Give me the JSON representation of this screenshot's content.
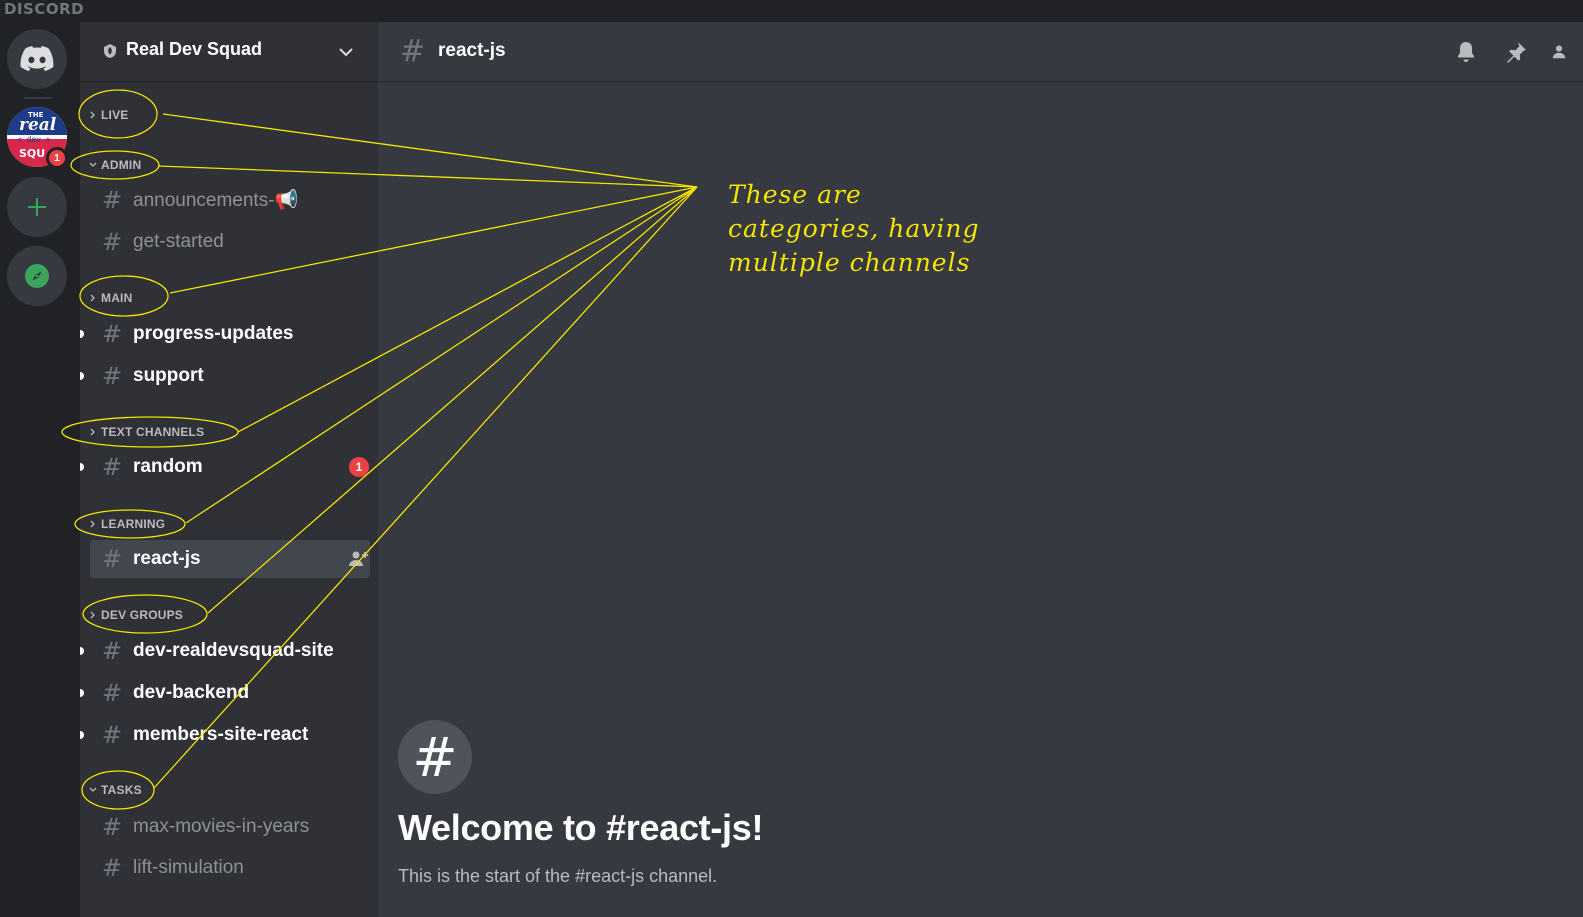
{
  "app": {
    "brand": "DISCORD"
  },
  "server": {
    "name": "Real Dev Squad",
    "notification_count": "1",
    "logo_text": {
      "the": "THE",
      "real": "real",
      "dev": "< dev >",
      "squad": "SQU"
    }
  },
  "sidebar": {
    "categories": [
      {
        "label": "LIVE",
        "expanded": false,
        "channels": []
      },
      {
        "label": "ADMIN",
        "expanded": true,
        "channels": [
          {
            "name": "announcements-📢",
            "state": "muted"
          },
          {
            "name": "get-started",
            "state": "muted"
          }
        ]
      },
      {
        "label": "MAIN",
        "expanded": false,
        "channels": [
          {
            "name": "progress-updates",
            "state": "unread"
          },
          {
            "name": "support",
            "state": "unread"
          }
        ]
      },
      {
        "label": "TEXT CHANNELS",
        "expanded": false,
        "channels": [
          {
            "name": "random",
            "state": "unread",
            "mention_count": "1"
          }
        ]
      },
      {
        "label": "LEARNING",
        "expanded": false,
        "channels": [
          {
            "name": "react-js",
            "state": "selected"
          }
        ]
      },
      {
        "label": "DEV GROUPS",
        "expanded": false,
        "channels": [
          {
            "name": "dev-realdevsquad-site",
            "state": "unread"
          },
          {
            "name": "dev-backend",
            "state": "unread"
          },
          {
            "name": "members-site-react",
            "state": "unread"
          }
        ]
      },
      {
        "label": "TASKS",
        "expanded": true,
        "channels": [
          {
            "name": "max-movies-in-years",
            "state": "muted"
          },
          {
            "name": "lift-simulation",
            "state": "muted"
          }
        ]
      }
    ]
  },
  "main": {
    "channel_title": "react-js",
    "welcome_title": "Welcome to #react-js!",
    "welcome_subtitle": "This is the start of the #react-js channel."
  },
  "annotation": {
    "lines": [
      "These are",
      "categories, having",
      "multiple channels"
    ],
    "color": "#f2e300"
  },
  "icons": {
    "home": "discord-logo-icon",
    "add_server": "plus-icon",
    "explore": "compass-icon",
    "server_boost": "shield-icon",
    "server_menu": "chevron-down-icon",
    "notifications": "bell-icon",
    "pins": "pin-icon",
    "members": "members-icon",
    "invite": "add-member-icon"
  },
  "colors": {
    "accent_green": "#3ba55d",
    "mention_red": "#ed4245",
    "selected_bg": "#42464d"
  }
}
